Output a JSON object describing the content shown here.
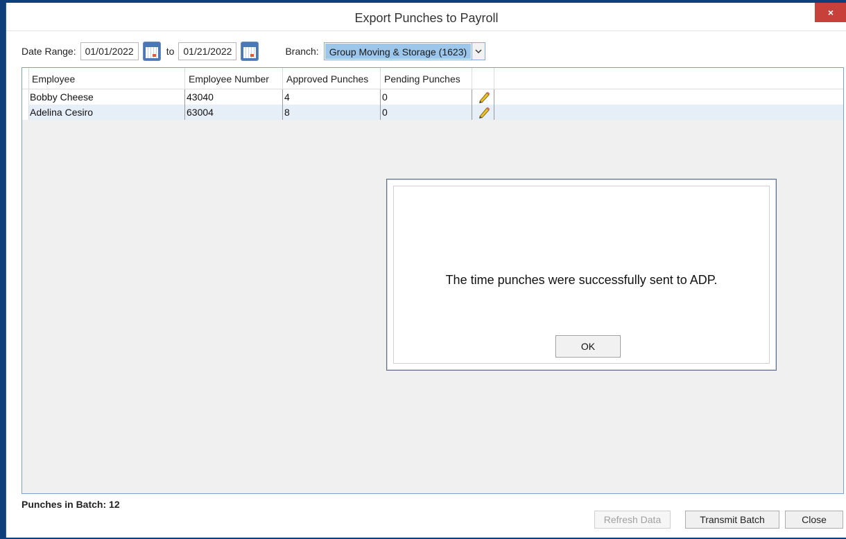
{
  "window": {
    "title": "Export Punches to Payroll",
    "close_glyph": "×"
  },
  "filters": {
    "date_range_label": "Date Range:",
    "start_date": "01/01/2022",
    "to_label": "to",
    "end_date": "01/21/2022",
    "branch_label": "Branch:",
    "branch_value": "Group Moving & Storage (1623)"
  },
  "grid": {
    "columns": [
      "Employee",
      "Employee Number",
      "Approved Punches",
      "Pending Punches"
    ],
    "rows": [
      {
        "employee": "Bobby Cheese",
        "number": "43040",
        "approved": "4",
        "pending": "0"
      },
      {
        "employee": "Adelina Cesiro",
        "number": "63004",
        "approved": "8",
        "pending": "0"
      }
    ],
    "row_icon": "pencil-edit-icon"
  },
  "footer": {
    "punches_label": "Punches in Batch:",
    "punches_count": "12",
    "refresh_label": "Refresh Data",
    "transmit_label": "Transmit Batch",
    "close_label": "Close"
  },
  "dialog": {
    "message": "The time punches were successfully sent to ADP.",
    "ok_label": "OK"
  },
  "colors": {
    "desktop": "#0f3f7a",
    "close_button": "#c8403a",
    "selection": "#9cc6ea",
    "row_alt": "#e6eef8"
  }
}
